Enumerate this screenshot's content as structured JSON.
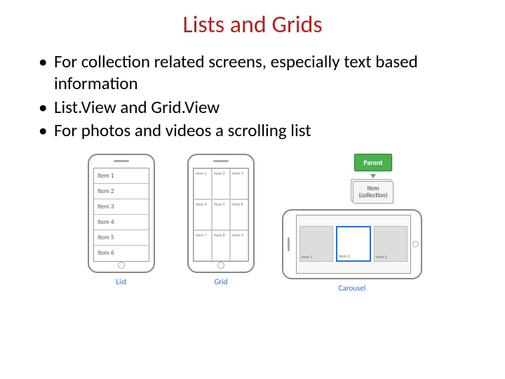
{
  "title": "Lists and Grids",
  "bullets": [
    "For collection related screens, especially text based information",
    "List.View and Grid.View",
    "For photos and videos a scrolling list"
  ],
  "list": {
    "items": [
      "Item 1",
      "Item 2",
      "Item 3",
      "Item 4",
      "Item 5",
      "Item 6"
    ],
    "caption": "List"
  },
  "grid": {
    "items": [
      "Item 1",
      "Item 2",
      "Item 3",
      "Item 4",
      "Item 5",
      "Item 6",
      "Item 7",
      "Item 8",
      "Item 9"
    ],
    "caption": "Grid"
  },
  "carousel": {
    "items": [
      "Item 1",
      "Item 2",
      "Item 3"
    ],
    "caption": "Carousel"
  },
  "nav": {
    "parent": "Parent",
    "item_line1": "Item",
    "item_line2": "(collection)"
  }
}
